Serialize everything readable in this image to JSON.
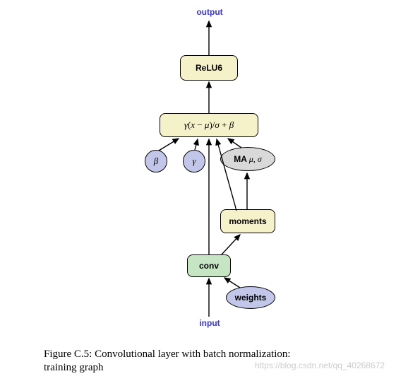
{
  "labels": {
    "output": "output",
    "input": "input"
  },
  "nodes": {
    "relu6": "ReLU6",
    "bn_formula_gamma": "γ",
    "bn_formula_lpar": "(",
    "bn_formula_x": "x",
    "bn_formula_minus": " − ",
    "bn_formula_mu": "μ",
    "bn_formula_rpar": ")",
    "bn_formula_div": "/",
    "bn_formula_sigma": "σ",
    "bn_formula_plus": " + ",
    "bn_formula_beta": "β",
    "beta": "β",
    "gamma": "γ",
    "ma_prefix": "MA ",
    "ma_mu": "μ",
    "ma_comma": ", ",
    "ma_sigma": "σ",
    "moments": "moments",
    "conv": "conv",
    "weights": "weights"
  },
  "caption": {
    "line1a": "Figure C.5:",
    "line1b": "  Convolutional layer with batch normalization:",
    "line2": "training graph"
  },
  "watermark": "https://blog.csdn.net/qq_40268672"
}
